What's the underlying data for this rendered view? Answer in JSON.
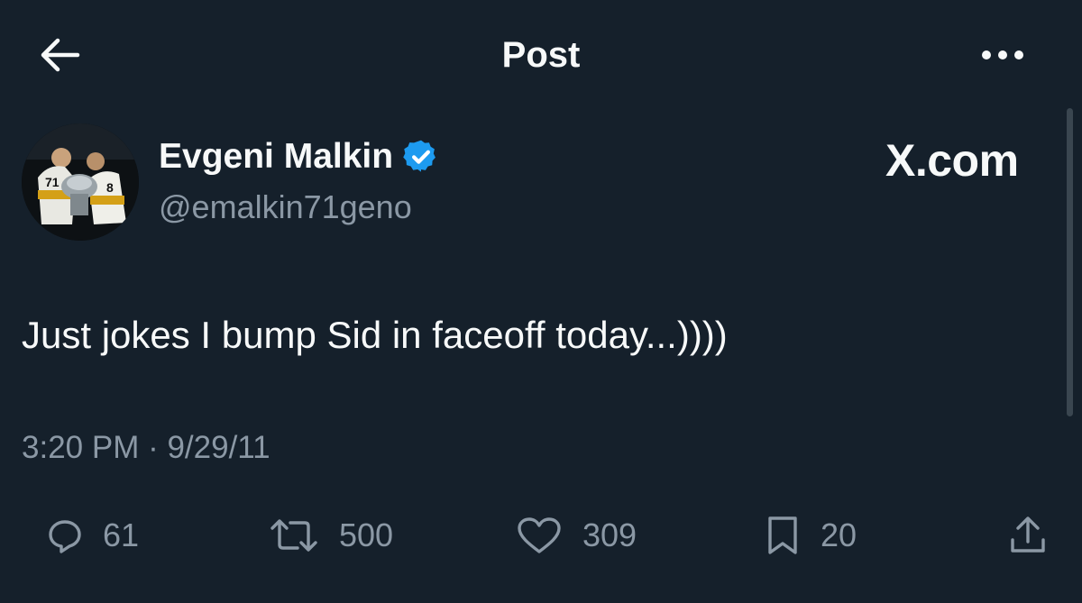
{
  "header": {
    "back_icon": "arrow-left-icon",
    "title": "Post",
    "more_icon": "more-horizontal-icon"
  },
  "post": {
    "author_name": "Evgeni Malkin",
    "verified": true,
    "verified_color": "#1d9bf0",
    "handle": "@emalkin71geno",
    "source_watermark": "X.com",
    "text": "Just jokes I bump Sid in faceoff today...))))",
    "timestamp": "3:20 PM · 9/29/11"
  },
  "actions": {
    "replies": {
      "icon": "reply-icon",
      "count": "61"
    },
    "reposts": {
      "icon": "repost-icon",
      "count": "500"
    },
    "likes": {
      "icon": "heart-icon",
      "count": "309"
    },
    "bookmarks": {
      "icon": "bookmark-icon",
      "count": "20"
    },
    "share": {
      "icon": "share-icon"
    }
  },
  "colors": {
    "background": "#15202b",
    "primary_text": "#f7f9f9",
    "secondary_text": "#8b98a5",
    "accent": "#1d9bf0"
  }
}
